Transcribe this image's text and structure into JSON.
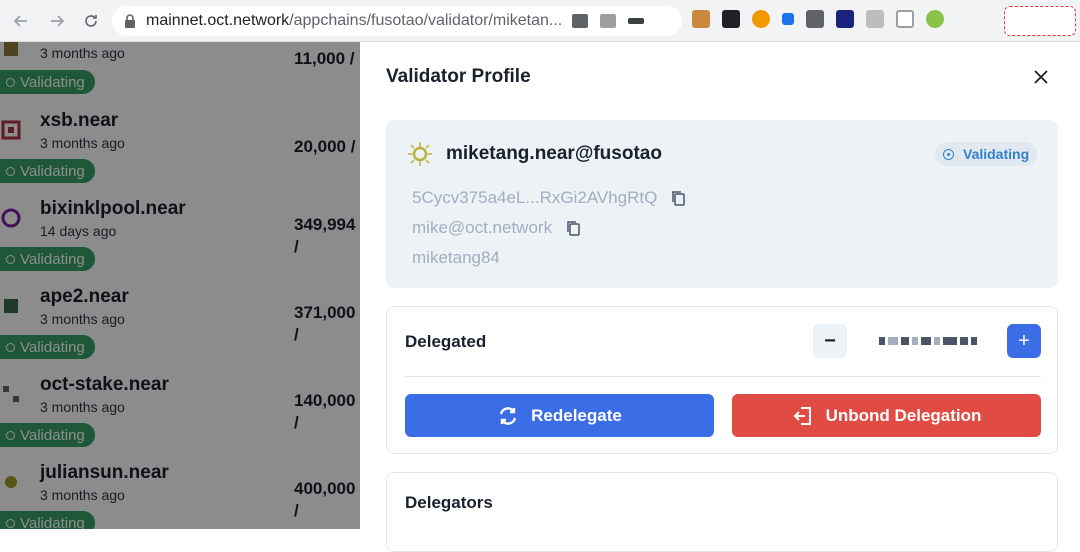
{
  "browser": {
    "url_host": "mainnet.oct.network",
    "url_path": "/appchains/fusotao/validator/miketan..."
  },
  "background_list": [
    {
      "name": "",
      "time": "3 months ago",
      "status": "Validating",
      "amount": "11,000 /"
    },
    {
      "name": "xsb.near",
      "time": "3 months ago",
      "status": "Validating",
      "amount": "20,000 /"
    },
    {
      "name": "bixinklpool.near",
      "time": "14 days ago",
      "status": "Validating",
      "amount": "349,994",
      "amount2": "/"
    },
    {
      "name": "ape2.near",
      "time": "3 months ago",
      "status": "Validating",
      "amount": "371,000",
      "amount2": "/"
    },
    {
      "name": "oct-stake.near",
      "time": "3 months ago",
      "status": "Validating",
      "amount": "140,000",
      "amount2": "/"
    },
    {
      "name": "juliansun.near",
      "time": "3 months ago",
      "status": "Validating",
      "amount": "400,000",
      "amount2": "/"
    }
  ],
  "drawer": {
    "title": "Validator Profile",
    "profile": {
      "name": "miketang.near@fusotao",
      "status": "Validating",
      "address": "5Cycv375a4eL...RxGi2AVhgRtQ",
      "email": "mike@oct.network",
      "handle": "miketang84"
    },
    "delegated": {
      "label": "Delegated",
      "minus": "−",
      "plus": "+",
      "redelegate_label": "Redelegate",
      "unbond_label": "Unbond Delegation"
    },
    "delegators": {
      "label": "Delegators"
    }
  },
  "colors": {
    "primary": "#3b6ee6",
    "danger": "#e04b44",
    "success": "#38a169",
    "status_blue": "#3182ce"
  }
}
